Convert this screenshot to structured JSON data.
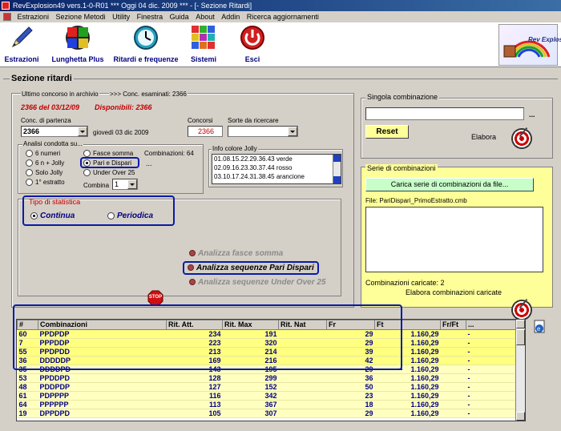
{
  "window": {
    "title": "RevExplosion49 vers.1-0-R01   ***   Oggi 04 dic. 2009   ***   - [- Sezione Ritardi]"
  },
  "menu": [
    "Estrazioni",
    "Sezione Metodi",
    "Utility",
    "Finestra",
    "Guida",
    "About",
    "Addin",
    "Ricerca aggiornamenti"
  ],
  "toolbar": [
    {
      "label": "Estrazioni",
      "icon": "pencil-icon"
    },
    {
      "label": "Lunghetta Plus",
      "icon": "color-grid-icon"
    },
    {
      "label": "Ritardi e frequenze",
      "icon": "clock-icon"
    },
    {
      "label": "Sistemi",
      "icon": "color-squares-icon"
    },
    {
      "label": "Esci",
      "icon": "power-icon"
    }
  ],
  "logo": {
    "text": "Rev Explosion"
  },
  "section_title": "Sezione ritardi",
  "left": {
    "archive_label": "Ultimo concorso in archivio",
    "examined_label": ">>> Conc. esaminati: 2366",
    "last_draw": "2366 del 03/12/09",
    "available": "Disponibili: 2366",
    "conc_partenza_label": "Conc. di partenza",
    "conc_partenza_value": "2366",
    "date_text": "giovedì 03 dic 2009",
    "concorsi_label": "Concorsi",
    "concorsi_value": "2366",
    "sorte_label": "Sorte da ricercare",
    "sorte_value": "",
    "analisi_label": "Analisi condotta su...",
    "analisi_options": [
      "6 numeri",
      "6 n + Jolly",
      "Solo Jolly",
      "1° estratto"
    ],
    "analisi_mid": [
      "Fasce somma",
      "Pari e Dispari",
      "Under Over 25"
    ],
    "combinazioni_label": "Combinazioni: 64",
    "ellipsis": "...",
    "combina_label": "Combina",
    "combina_value": "1",
    "jolly_label": "Info colore Jolly",
    "jolly_lines": [
      "01.08.15.22.29.36.43 verde",
      "02.09.16.23.30.37.44 rosso",
      "03.10.17.24.31.38.45 arancione"
    ],
    "tipo_label": "Tipo di statistica",
    "tipo_options": [
      "Continua",
      "Periodica"
    ],
    "actions": [
      "Analizza fasce somma",
      "Analizza sequenze Pari Dispari",
      "Analizza sequenze Under Over 25"
    ],
    "stop_label": "STOP"
  },
  "right": {
    "single_label": "Singola combinazione",
    "single_value": "",
    "ellipsis": "...",
    "reset_label": "Reset",
    "elabora_label": "Elabora",
    "serie_label": "Serie di combinazioni",
    "carica_label": "Carica serie di combinazioni da file...",
    "file_label": "File: PariDispari_PrimoEstratto.cmb",
    "caricate_label": "Combinazioni caricate: 2",
    "elabora_caricate_label": "Elabora combinazioni caricate"
  },
  "grid": {
    "headers": [
      "#",
      "Combinazioni",
      "Rit. Att.",
      "Rit. Max",
      "Rit. Nat",
      "Fr",
      "Ft",
      "Fr/Ft",
      "..."
    ],
    "rows": [
      [
        "60",
        "PPDPDP",
        "234",
        "191",
        "",
        "29",
        "1.160,29",
        "",
        "-"
      ],
      [
        "7",
        "PPPDDP",
        "223",
        "320",
        "",
        "29",
        "1.160,29",
        "",
        "-"
      ],
      [
        "55",
        "PPDPDD",
        "213",
        "214",
        "",
        "39",
        "1.160,29",
        "",
        "-"
      ],
      [
        "36",
        "DDDDDP",
        "169",
        "216",
        "",
        "42",
        "1.160,29",
        "",
        "-"
      ],
      [
        "35",
        "DDDDPD",
        "143",
        "195",
        "",
        "29",
        "1.160,29",
        "",
        "-"
      ],
      [
        "53",
        "PPDDPD",
        "128",
        "299",
        "",
        "36",
        "1.160,29",
        "",
        "-"
      ],
      [
        "48",
        "PDDPDP",
        "127",
        "152",
        "",
        "50",
        "1.160,29",
        "",
        "-"
      ],
      [
        "61",
        "PDPPPP",
        "116",
        "342",
        "",
        "23",
        "1.160,29",
        "",
        "-"
      ],
      [
        "64",
        "PPPPPP",
        "113",
        "367",
        "",
        "18",
        "1.160,29",
        "",
        "-"
      ],
      [
        "19",
        "DPPDPD",
        "105",
        "307",
        "",
        "29",
        "1.160,29",
        "",
        "-"
      ]
    ]
  },
  "colors": {
    "accent_red": "#c00000",
    "annotation_blue": "#0a1aa8",
    "panel_yellow": "#ffff99",
    "title_blue": "#0a246a"
  }
}
